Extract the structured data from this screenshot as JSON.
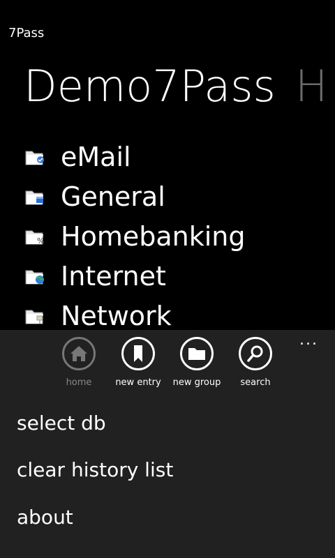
{
  "app": {
    "title": "7Pass"
  },
  "pivot": {
    "active": "Demo7Pass",
    "next": "H"
  },
  "groups": [
    {
      "label": "eMail",
      "icon": "email-folder-icon"
    },
    {
      "label": "General",
      "icon": "general-folder-icon"
    },
    {
      "label": "Homebanking",
      "icon": "homebanking-folder-icon"
    },
    {
      "label": "Internet",
      "icon": "internet-folder-icon"
    },
    {
      "label": "Network",
      "icon": "network-folder-icon"
    }
  ],
  "appbar": {
    "more": "...",
    "buttons": [
      {
        "label": "home",
        "icon": "home-icon",
        "enabled": false
      },
      {
        "label": "new entry",
        "icon": "bookmark-icon",
        "enabled": true
      },
      {
        "label": "new group",
        "icon": "folder-icon",
        "enabled": true
      },
      {
        "label": "search",
        "icon": "search-icon",
        "enabled": true
      }
    ],
    "menu": [
      "select db",
      "clear history list",
      "about"
    ]
  }
}
